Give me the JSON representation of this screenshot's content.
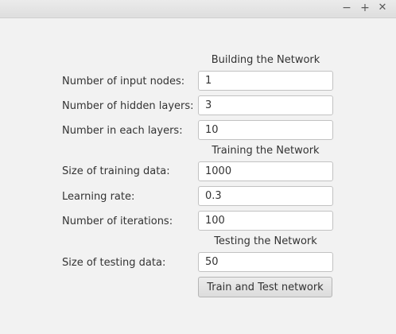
{
  "window": {
    "minimize_glyph": "−",
    "maximize_glyph": "+",
    "close_glyph": "✕"
  },
  "building": {
    "heading": "Building the Network",
    "input_nodes_label": "Number of input nodes:",
    "input_nodes_value": "1",
    "hidden_layers_label": "Number of hidden layers:",
    "hidden_layers_value": "3",
    "each_layer_label": "Number in each layers:",
    "each_layer_value": "10"
  },
  "training": {
    "heading": "Training the Network",
    "data_size_label": "Size of training data:",
    "data_size_value": "1000",
    "learning_rate_label": "Learning rate:",
    "learning_rate_value": "0.3",
    "iterations_label": "Number of iterations:",
    "iterations_value": "100"
  },
  "testing": {
    "heading": "Testing the Network",
    "data_size_label": "Size of testing data:",
    "data_size_value": "50",
    "button_label": "Train and Test network"
  }
}
